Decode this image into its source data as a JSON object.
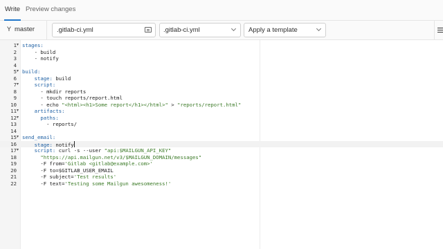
{
  "tabs": [
    {
      "label": "Write",
      "active": true
    },
    {
      "label": "Preview changes",
      "active": false
    }
  ],
  "toolbar": {
    "branch": "master",
    "branch_icon": "branch-icon",
    "filename": ".gitlab-ci.yml",
    "template_type": ".gitlab-ci.yml",
    "apply_template": "Apply a template"
  },
  "editor": {
    "active_line": 16,
    "lines": [
      {
        "n": "1",
        "fold": true,
        "tokens": [
          {
            "t": "stages:",
            "c": "key"
          }
        ]
      },
      {
        "n": "2",
        "fold": false,
        "tokens": [
          {
            "t": "    - build",
            "c": ""
          }
        ]
      },
      {
        "n": "3",
        "fold": false,
        "tokens": [
          {
            "t": "    - notify",
            "c": ""
          }
        ]
      },
      {
        "n": "4",
        "fold": false,
        "tokens": []
      },
      {
        "n": "5",
        "fold": true,
        "tokens": [
          {
            "t": "build:",
            "c": "key"
          }
        ]
      },
      {
        "n": "6",
        "fold": false,
        "tokens": [
          {
            "t": "    ",
            "c": ""
          },
          {
            "t": "stage:",
            "c": "key"
          },
          {
            "t": " build",
            "c": ""
          }
        ]
      },
      {
        "n": "7",
        "fold": true,
        "tokens": [
          {
            "t": "    ",
            "c": ""
          },
          {
            "t": "script:",
            "c": "key"
          }
        ]
      },
      {
        "n": "8",
        "fold": false,
        "tokens": [
          {
            "t": "      - mkdir reports",
            "c": ""
          }
        ]
      },
      {
        "n": "9",
        "fold": false,
        "tokens": [
          {
            "t": "      - touch reports/report.html",
            "c": ""
          }
        ]
      },
      {
        "n": "10",
        "fold": false,
        "tokens": [
          {
            "t": "      - echo ",
            "c": ""
          },
          {
            "t": "\"<html><h1>Some report</h1></html>\"",
            "c": "str"
          },
          {
            "t": " > ",
            "c": ""
          },
          {
            "t": "\"reports/report.html\"",
            "c": "str"
          }
        ]
      },
      {
        "n": "11",
        "fold": true,
        "tokens": [
          {
            "t": "    ",
            "c": ""
          },
          {
            "t": "artifacts:",
            "c": "key"
          }
        ]
      },
      {
        "n": "12",
        "fold": true,
        "tokens": [
          {
            "t": "      ",
            "c": ""
          },
          {
            "t": "paths:",
            "c": "key"
          }
        ]
      },
      {
        "n": "13",
        "fold": false,
        "tokens": [
          {
            "t": "        - reports/",
            "c": ""
          }
        ]
      },
      {
        "n": "14",
        "fold": false,
        "tokens": []
      },
      {
        "n": "15",
        "fold": true,
        "tokens": [
          {
            "t": "send_email:",
            "c": "key"
          }
        ]
      },
      {
        "n": "16",
        "fold": false,
        "tokens": [
          {
            "t": "    ",
            "c": ""
          },
          {
            "t": "stage:",
            "c": "key"
          },
          {
            "t": " notify",
            "c": ""
          }
        ],
        "cursor": true
      },
      {
        "n": "17",
        "fold": true,
        "tokens": [
          {
            "t": "    ",
            "c": ""
          },
          {
            "t": "script:",
            "c": "key"
          },
          {
            "t": " curl -s --user ",
            "c": ""
          },
          {
            "t": "\"api:$MAILGUN_API_KEY\"",
            "c": "str"
          }
        ]
      },
      {
        "n": "18",
        "fold": false,
        "tokens": [
          {
            "t": "      ",
            "c": ""
          },
          {
            "t": "\"https://api.mailgun.net/v3/$MAILGUN_DOMAIN/messages\"",
            "c": "str"
          }
        ]
      },
      {
        "n": "19",
        "fold": false,
        "tokens": [
          {
            "t": "      -F from=",
            "c": ""
          },
          {
            "t": "'Gitlab <gitlab@example.com>'",
            "c": "str"
          }
        ]
      },
      {
        "n": "20",
        "fold": false,
        "tokens": [
          {
            "t": "      -F to=$GITLAB_USER_EMAIL",
            "c": ""
          }
        ]
      },
      {
        "n": "21",
        "fold": false,
        "tokens": [
          {
            "t": "      -F subject=",
            "c": ""
          },
          {
            "t": "'Test results'",
            "c": "str"
          }
        ]
      },
      {
        "n": "22",
        "fold": false,
        "tokens": [
          {
            "t": "      -F text=",
            "c": ""
          },
          {
            "t": "'Testing some Mailgun awesomeness!'",
            "c": "str"
          }
        ]
      }
    ]
  },
  "colors": {
    "accent": "#1f75cb",
    "key": "#1d5fa3",
    "string": "#3b7a27"
  }
}
